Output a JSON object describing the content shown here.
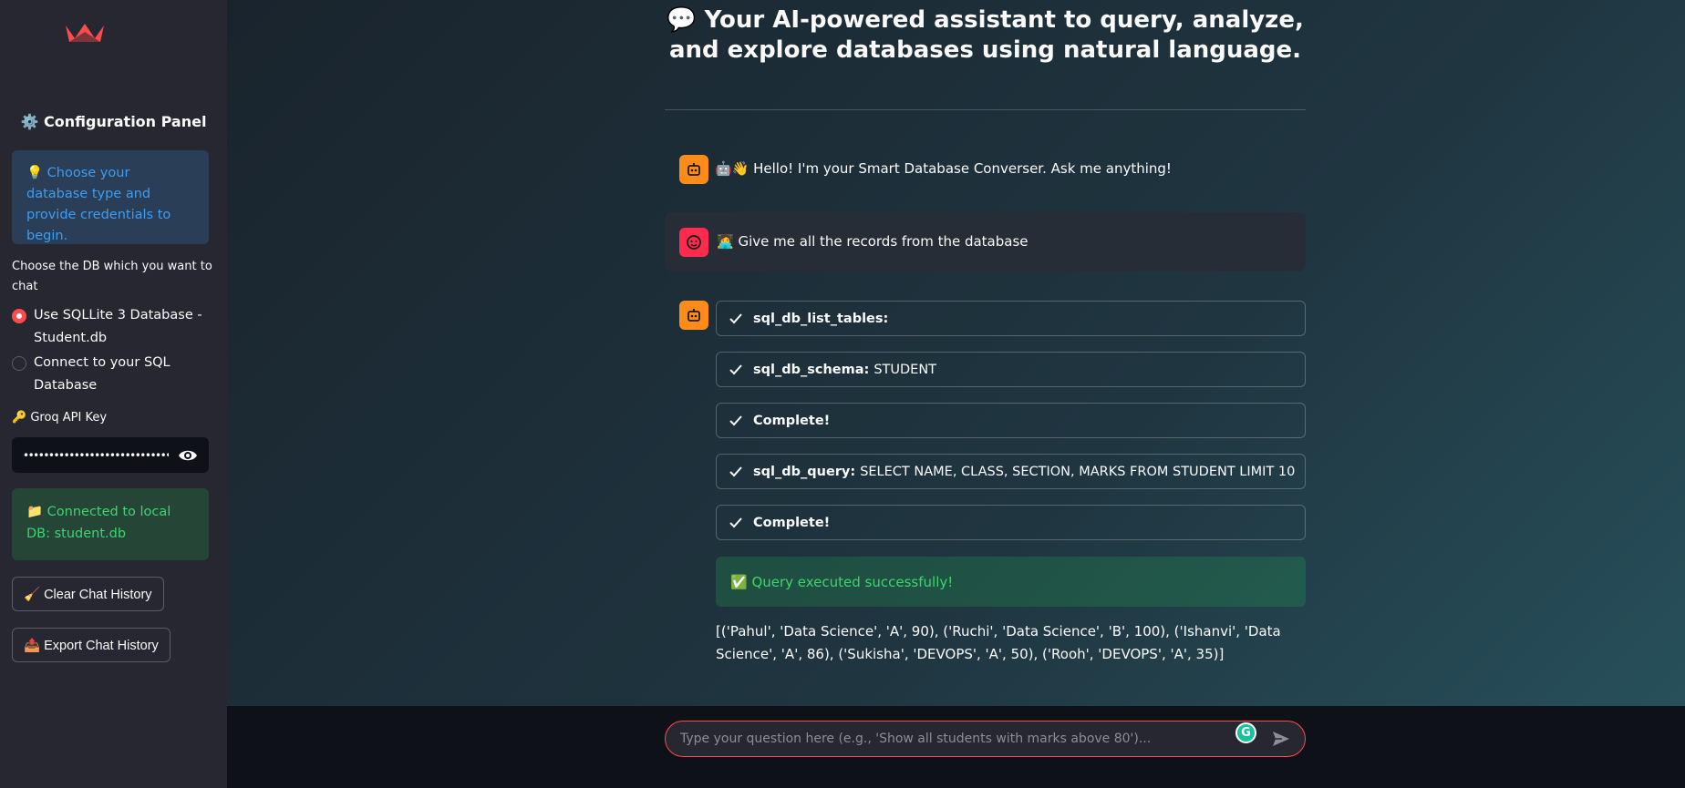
{
  "sidebar": {
    "panel_title": "⚙️ Configuration Panel",
    "info": "💡 Choose your database type and provide credentials to begin.",
    "radio_label": "Choose the DB which you want to chat",
    "radio_options": [
      {
        "label": "Use SQLLite 3 Database - Student.db",
        "selected": true
      },
      {
        "label": "Connect to your SQL Database",
        "selected": false
      }
    ],
    "api_key_label": "🔑 Groq API Key",
    "api_key_value": "••••••••••••••••••••••••••••••••••••••",
    "connected": "📁 Connected to local DB: student.db",
    "clear_button": "🧹 Clear Chat History",
    "export_button": "📤 Export Chat History"
  },
  "main": {
    "title": "💬 Your AI-powered assistant to query, analyze, and explore databases using natural language.",
    "messages": [
      {
        "role": "assistant",
        "text": "🤖👋 Hello! I'm your Smart Database Converser. Ask me anything!"
      },
      {
        "role": "user",
        "text": "🧑‍💻 Give me all the records from the database"
      }
    ],
    "steps": [
      {
        "label": "sql_db_list_tables:",
        "detail": ""
      },
      {
        "label": "sql_db_schema:",
        "detail": "STUDENT"
      },
      {
        "label": "Complete!",
        "detail": ""
      },
      {
        "label": "sql_db_query:",
        "detail": "SELECT NAME, CLASS, SECTION, MARKS FROM STUDENT LIMIT 10"
      },
      {
        "label": "Complete!",
        "detail": ""
      }
    ],
    "success": "✅ Query executed successfully!",
    "result": "[('Pahul', 'Data Science', 'A', 90), ('Ruchi', 'Data Science', 'B', 100), ('Ishanvi', 'Data Science', 'A', 86), ('Sukisha', 'DEVOPS', 'A', 50), ('Rooh', 'DEVOPS', 'A', 35)]"
  },
  "chat_input": {
    "placeholder": "Type your question here (e.g., 'Show all students with marks above 80')...",
    "value": ""
  },
  "colors": {
    "accent": "#ff4b4b",
    "sidebar_bg": "#262730",
    "info": "#3d9df3",
    "success": "#3dd56d",
    "bot_avatar": "#ff8c1a",
    "user_avatar": "#ff2b4f"
  }
}
